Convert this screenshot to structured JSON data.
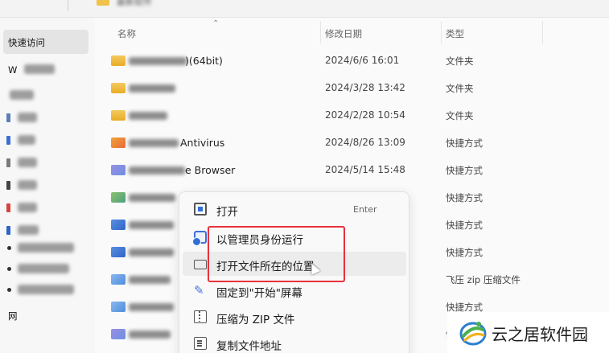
{
  "breadcrumb": {
    "current": "最新软件"
  },
  "nav": {
    "items": [
      {
        "label": "快速访问",
        "selected": true
      },
      {
        "label": "W"
      },
      {
        "label": ""
      }
    ],
    "bottom_label": "网"
  },
  "list": {
    "columns": {
      "name": "名称",
      "modified": "修改日期",
      "type": "类型"
    },
    "rows": [
      {
        "name_visible": ")(64bit)",
        "date": "2024/6/6 16:01",
        "type": "文件夹"
      },
      {
        "name_visible": "",
        "date": "2024/3/28 13:42",
        "type": "文件夹"
      },
      {
        "name_visible": "",
        "date": "2024/2/28 10:54",
        "type": "文件夹"
      },
      {
        "name_visible": "Antivirus",
        "date": "2024/8/26 13:09",
        "type": "快捷方式"
      },
      {
        "name_visible": "e Browser",
        "date": "2024/5/14 15:48",
        "type": "快捷方式"
      },
      {
        "name_visible": "",
        "date": "",
        "type": "快捷方式"
      },
      {
        "name_visible": "",
        "date": "",
        "type": "快捷方式"
      },
      {
        "name_visible": "",
        "date": "",
        "type": "快捷方式"
      },
      {
        "name_visible": "",
        "date": "",
        "type": "飞压 zip 压缩文件"
      },
      {
        "name_visible": "",
        "date": "",
        "type": "快捷方式"
      },
      {
        "name_visible": "",
        "date": "",
        "type": "快捷方式"
      }
    ]
  },
  "context_menu": {
    "items": [
      {
        "label": "打开",
        "shortcut": "Enter",
        "icon": "open-icon"
      },
      {
        "label": "以管理员身份运行",
        "icon": "admin-shield-icon"
      },
      {
        "label": "打开文件所在的位置",
        "icon": "folder-outline-icon",
        "hovered": true
      },
      {
        "label": "固定到\"开始\"屏幕",
        "icon": "pin-icon"
      },
      {
        "label": "压缩为 ZIP 文件",
        "icon": "zip-icon"
      },
      {
        "label": "复制文件地址",
        "icon": "copy-path-icon"
      }
    ]
  },
  "highlight_color": "#e8313c",
  "watermark": {
    "text": "云之居软件园"
  }
}
